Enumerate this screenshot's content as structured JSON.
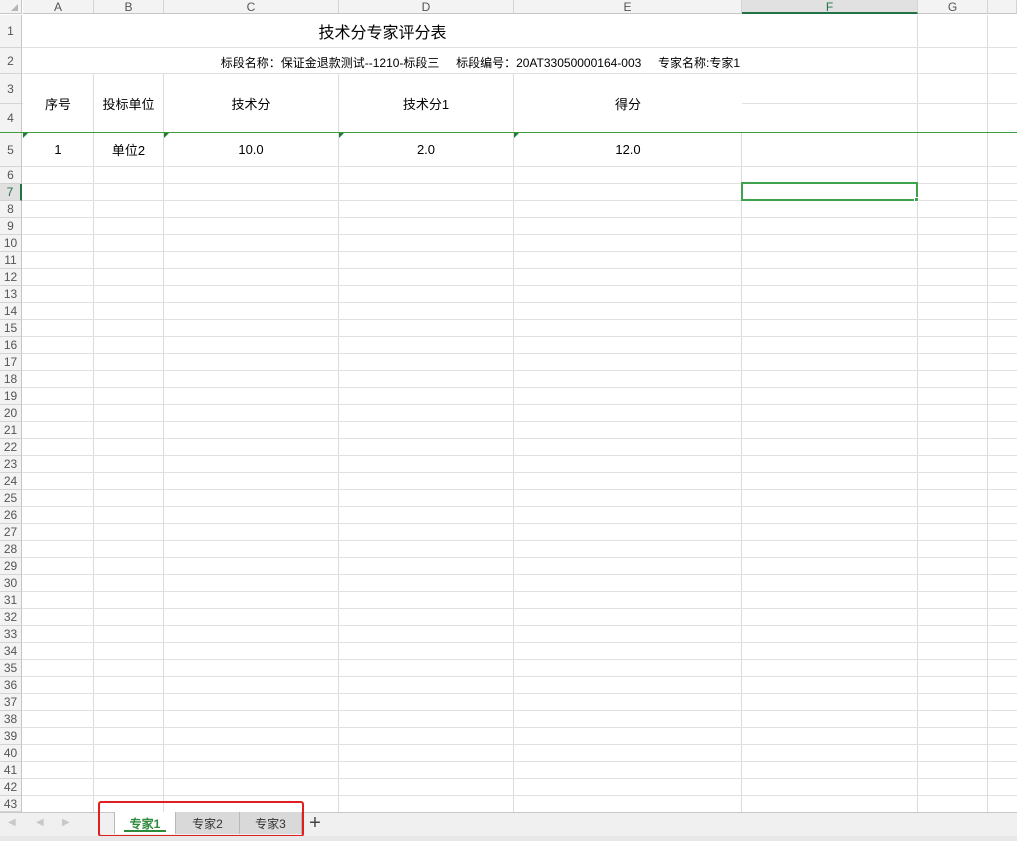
{
  "columns": [
    "A",
    "B",
    "C",
    "D",
    "E",
    "F",
    "G"
  ],
  "selected_column": "F",
  "rows": [
    "1",
    "2",
    "3",
    "4",
    "5",
    "6",
    "7",
    "8",
    "9",
    "10",
    "11",
    "12",
    "13",
    "14",
    "15",
    "16",
    "17",
    "18",
    "19",
    "20",
    "21",
    "22",
    "23",
    "24",
    "25",
    "26",
    "27",
    "28",
    "29",
    "30",
    "31",
    "32",
    "33",
    "34",
    "35",
    "36",
    "37",
    "38",
    "39",
    "40",
    "41",
    "42",
    "43"
  ],
  "selected_row": "7",
  "sheet": {
    "title": "技术分专家评分表",
    "subtitle": "标段名称：保证金退款测试--1210-标段三     标段编号：20AT33050000164-003     专家名称:专家1",
    "headers": {
      "seq": "序号",
      "unit": "投标单位",
      "tech": "技术分",
      "tech1": "技术分1",
      "score": "得分"
    },
    "row5": {
      "seq": "1",
      "unit": "单位2",
      "tech": "10.0",
      "tech1": "2.0",
      "score": "12.0"
    }
  },
  "tabs": [
    "专家1",
    "专家2",
    "专家3"
  ],
  "active_tab": "专家1",
  "add_sheet_icon": "plus-icon",
  "colors": {
    "accent_green": "#217346",
    "selection_green": "#3fa34d",
    "highlight_red": "#e02020"
  }
}
